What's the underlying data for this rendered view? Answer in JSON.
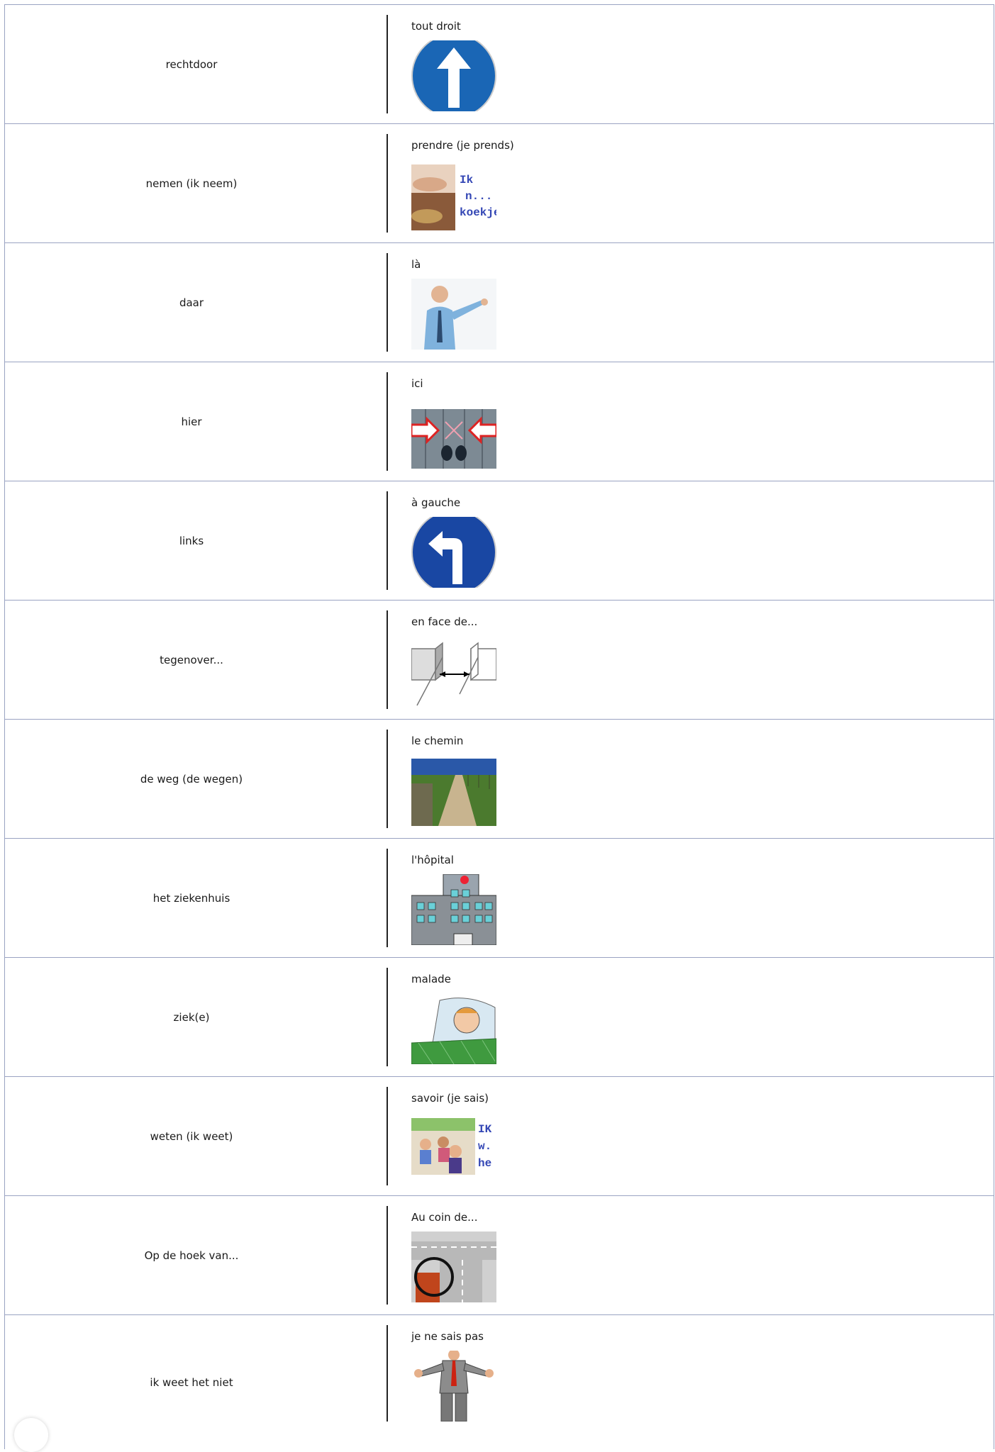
{
  "rows": [
    {
      "nl": "rechtdoor",
      "fr": "tout droit",
      "icon": "arrow-up-sign-icon"
    },
    {
      "nl": "nemen (ik neem)",
      "fr": "prendre (je prends)",
      "icon": "hand-cookie-icon",
      "image_text": "Ik n... e koekje"
    },
    {
      "nl": "daar",
      "fr": "là",
      "icon": "pointing-man-icon"
    },
    {
      "nl": "hier",
      "fr": "ici",
      "icon": "feet-arrows-icon"
    },
    {
      "nl": "links",
      "fr": "à gauche",
      "icon": "turn-left-sign-icon"
    },
    {
      "nl": "tegenover...",
      "fr": "en face de...",
      "icon": "opposite-blocks-icon"
    },
    {
      "nl": "de weg (de wegen)",
      "fr": "le chemin",
      "icon": "country-path-icon"
    },
    {
      "nl": "het ziekenhuis",
      "fr": "l'hôpital",
      "icon": "hospital-icon"
    },
    {
      "nl": "ziek(e)",
      "fr": "malade",
      "icon": "sick-child-icon"
    },
    {
      "nl": "weten (ik weet)",
      "fr": "savoir (je sais)",
      "icon": "classroom-icon",
      "image_text": "IK w.. he"
    },
    {
      "nl": "Op de hoek van...",
      "fr": "Au coin de...",
      "icon": "street-corner-icon"
    },
    {
      "nl": "ik weet het niet",
      "fr": "je ne sais pas",
      "icon": "shrugging-man-icon"
    }
  ]
}
